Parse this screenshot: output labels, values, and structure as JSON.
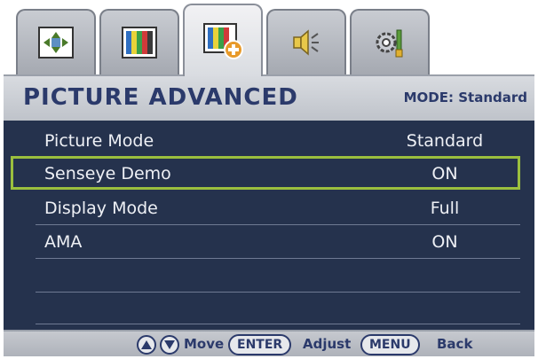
{
  "tabs": [
    {
      "id": "display",
      "icon": "display-adjust-icon",
      "active": false
    },
    {
      "id": "picture",
      "icon": "picture-color-bars-icon",
      "active": false
    },
    {
      "id": "picture-advanced",
      "icon": "picture-advanced-icon",
      "active": true
    },
    {
      "id": "audio",
      "icon": "speaker-icon",
      "active": false
    },
    {
      "id": "system",
      "icon": "system-settings-icon",
      "active": false
    }
  ],
  "header": {
    "title": "PICTURE ADVANCED",
    "mode": "MODE: Standard"
  },
  "menu": {
    "items": [
      {
        "label": "Picture Mode",
        "value": "Standard",
        "selected": false
      },
      {
        "label": "Senseye Demo",
        "value": "ON",
        "selected": true
      },
      {
        "label": "Display Mode",
        "value": "Full",
        "selected": false
      },
      {
        "label": "AMA",
        "value": "ON",
        "selected": false
      },
      {
        "label": "",
        "value": "",
        "selected": false
      },
      {
        "label": "",
        "value": "",
        "selected": false
      }
    ]
  },
  "footer": {
    "move_label": "Move",
    "enter_key": "ENTER",
    "adjust_label": "Adjust",
    "menu_key": "MENU",
    "back_label": "Back"
  },
  "colors": {
    "background": "#25324d",
    "header": "#c9ccd2",
    "text": "#2b3a6b",
    "selection": "#9bbf3e"
  }
}
